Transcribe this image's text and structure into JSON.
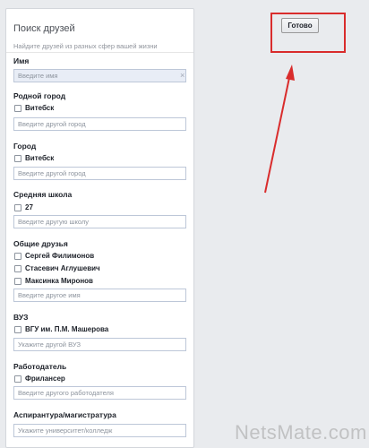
{
  "panel": {
    "title": "Поиск друзей",
    "subtitle": "Найдите друзей из разных сфер вашей жизни"
  },
  "name_section": {
    "label": "Имя",
    "placeholder": "Введите имя",
    "clear_icon": "×"
  },
  "hometown": {
    "label": "Родной город",
    "options": [
      "Витебск"
    ],
    "placeholder": "Введите другой город"
  },
  "city": {
    "label": "Город",
    "options": [
      "Витебск"
    ],
    "placeholder": "Введите другой город"
  },
  "school": {
    "label": "Средняя школа",
    "options": [
      "27"
    ],
    "placeholder": "Введите другую школу"
  },
  "mutual_friends": {
    "label": "Общие друзья",
    "options": [
      "Сергей Филимонов",
      "Стасевич Аглушевич",
      "Максинка Миронов"
    ],
    "placeholder": "Введите другое имя"
  },
  "university": {
    "label": "ВУЗ",
    "options": [
      "ВГУ им. П.М. Машерова"
    ],
    "placeholder": "Укажите другой ВУЗ"
  },
  "employer": {
    "label": "Работодатель",
    "options": [
      "Фрилансер"
    ],
    "placeholder": "Введите другого работодателя"
  },
  "graduate": {
    "label": "Аспирантура/магистратура",
    "placeholder": "Укажите университет/колледж"
  },
  "done_button": {
    "label": "Готово"
  },
  "annotation": {
    "color": "#d92c2c"
  },
  "watermark": {
    "text": "NetsMate.com"
  }
}
